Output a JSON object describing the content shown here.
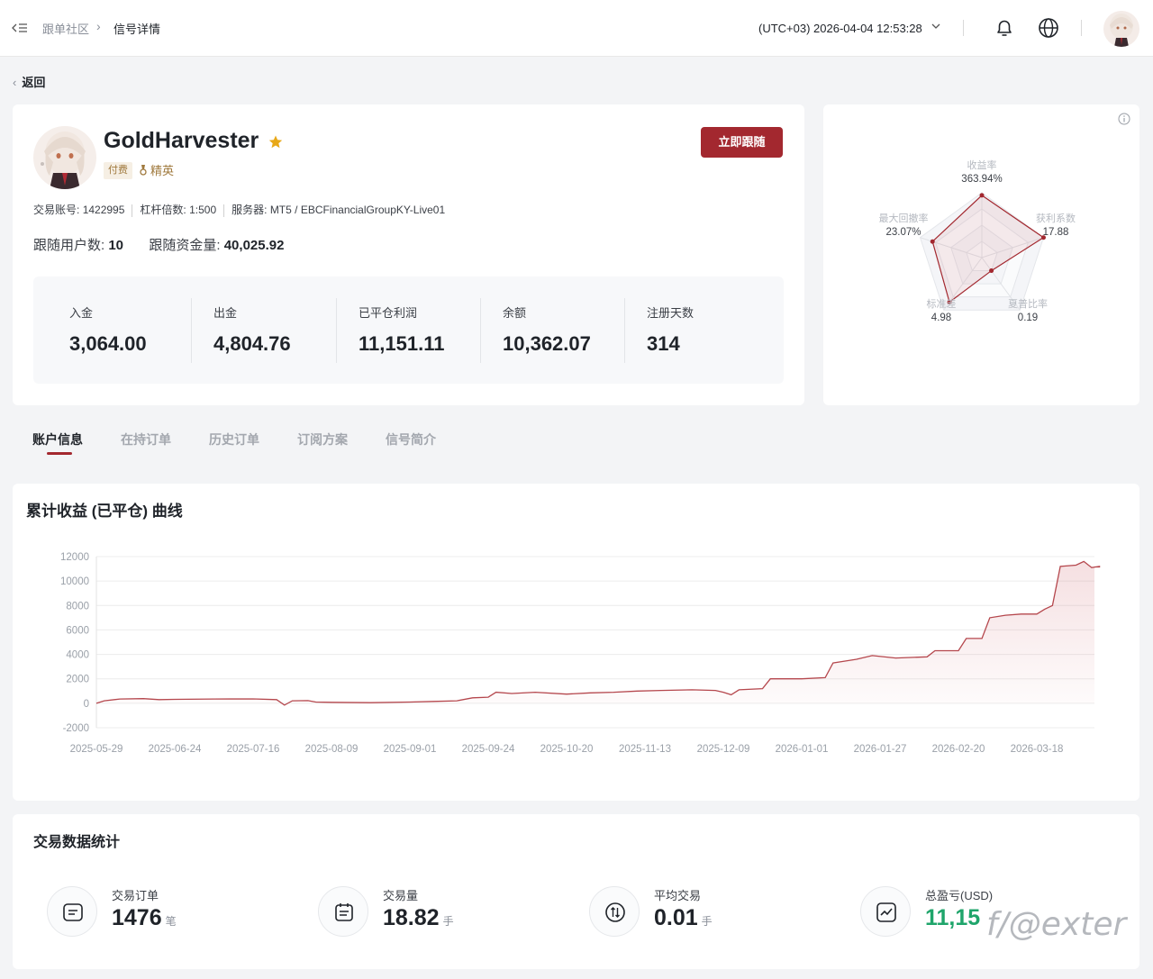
{
  "header": {
    "breadcrumb": [
      "跟单社区",
      "信号详情"
    ],
    "timezone": "(UTC+03)  2026-04-04 12:53:28"
  },
  "back_label": "返回",
  "profile": {
    "name": "GoldHarvester",
    "tag_paid": "付费",
    "tag_elite": "精英",
    "follow_button": "立即跟随",
    "account_label": "交易账号:",
    "account": "1422995",
    "leverage_label": "杠杆倍数:",
    "leverage": "1:500",
    "server_label": "服务器:",
    "server": "MT5 / EBCFinancialGroupKY-Live01",
    "followers_label": "跟随用户数:",
    "followers": "10",
    "follow_funds_label": "跟随资金量:",
    "follow_funds": "40,025.92",
    "stats": [
      {
        "label": "入金",
        "value": "3,064.00"
      },
      {
        "label": "出金",
        "value": "4,804.76"
      },
      {
        "label": "已平仓利润",
        "value": "11,151.11"
      },
      {
        "label": "余额",
        "value": "10,362.07"
      },
      {
        "label": "注册天数",
        "value": "314"
      }
    ]
  },
  "radar": {
    "axes": [
      {
        "label": "收益率",
        "value": "363.94%",
        "level": 0.96
      },
      {
        "label": "获利系数",
        "value": "17.88",
        "level": 1.0
      },
      {
        "label": "夏普比率",
        "value": "0.19",
        "level": 0.25
      },
      {
        "label": "标准差",
        "value": "4.98",
        "level": 0.85
      },
      {
        "label": "最大回撤率",
        "value": "23.07%",
        "level": 0.8
      }
    ],
    "accent": "#a3282f"
  },
  "tabs": [
    "账户信息",
    "在持订单",
    "历史订单",
    "订阅方案",
    "信号简介"
  ],
  "chart_title": "累计收益 (已平仓) 曲线",
  "chart_data": {
    "type": "area",
    "title": "累计收益 (已平仓) 曲线",
    "xlabel": "",
    "ylabel": "",
    "ylim": [
      -2000,
      12000
    ],
    "yticks": [
      "12000",
      "10000",
      "8000",
      "6000",
      "4000",
      "2000",
      "0",
      "-2000"
    ],
    "xticks": [
      "2025-05-29",
      "2025-06-24",
      "2025-07-16",
      "2025-08-09",
      "2025-09-01",
      "2025-09-24",
      "2025-10-20",
      "2025-11-13",
      "2025-12-09",
      "2026-01-01",
      "2026-01-27",
      "2026-02-20",
      "2026-03-18"
    ],
    "grid": true,
    "color": "#b5474d",
    "series": [
      {
        "values": [
          [
            0,
            0
          ],
          [
            0.1,
            200
          ],
          [
            0.3,
            350
          ],
          [
            0.6,
            380
          ],
          [
            0.8,
            300
          ],
          [
            1.0,
            320
          ],
          [
            1.5,
            350
          ],
          [
            2.0,
            360
          ],
          [
            2.3,
            300
          ],
          [
            2.4,
            -150
          ],
          [
            2.5,
            200
          ],
          [
            2.7,
            220
          ],
          [
            2.8,
            100
          ],
          [
            3.0,
            80
          ],
          [
            3.5,
            50
          ],
          [
            4.0,
            100
          ],
          [
            4.3,
            150
          ],
          [
            4.6,
            200
          ],
          [
            4.8,
            450
          ],
          [
            5.0,
            500
          ],
          [
            5.1,
            900
          ],
          [
            5.3,
            800
          ],
          [
            5.6,
            900
          ],
          [
            6.0,
            750
          ],
          [
            6.3,
            850
          ],
          [
            6.6,
            900
          ],
          [
            6.9,
            1000
          ],
          [
            7.2,
            1050
          ],
          [
            7.6,
            1100
          ],
          [
            7.9,
            1050
          ],
          [
            8.0,
            900
          ],
          [
            8.1,
            700
          ],
          [
            8.2,
            1100
          ],
          [
            8.5,
            1200
          ],
          [
            8.6,
            2000
          ],
          [
            9.0,
            2000
          ],
          [
            9.3,
            2100
          ],
          [
            9.4,
            3300
          ],
          [
            9.6,
            3500
          ],
          [
            9.7,
            3600
          ],
          [
            9.9,
            3900
          ],
          [
            10.2,
            3700
          ],
          [
            10.6,
            3800
          ],
          [
            10.7,
            4300
          ],
          [
            11.0,
            4300
          ],
          [
            11.1,
            5300
          ],
          [
            11.3,
            5300
          ],
          [
            11.4,
            7000
          ],
          [
            11.6,
            7200
          ],
          [
            11.8,
            7300
          ],
          [
            12.0,
            7300
          ],
          [
            12.1,
            7700
          ],
          [
            12.2,
            8000
          ],
          [
            12.3,
            11200
          ],
          [
            12.5,
            11300
          ],
          [
            12.6,
            11600
          ],
          [
            12.7,
            11100
          ],
          [
            12.8,
            11200
          ],
          [
            12.8,
            11151
          ]
        ]
      }
    ]
  },
  "trade_title": "交易数据统计",
  "trade_stats": [
    {
      "label": "交易订单",
      "value": "1476",
      "unit": "笔",
      "icon": "order-icon"
    },
    {
      "label": "交易量",
      "value": "18.82",
      "unit": "手",
      "icon": "calendar-icon"
    },
    {
      "label": "平均交易",
      "value": "0.01",
      "unit": "手",
      "icon": "exchange-icon"
    },
    {
      "label": "总盈亏(USD)",
      "value": "11,15",
      "unit": "",
      "icon": "trend-icon"
    }
  ],
  "watermark": "f/@exter"
}
